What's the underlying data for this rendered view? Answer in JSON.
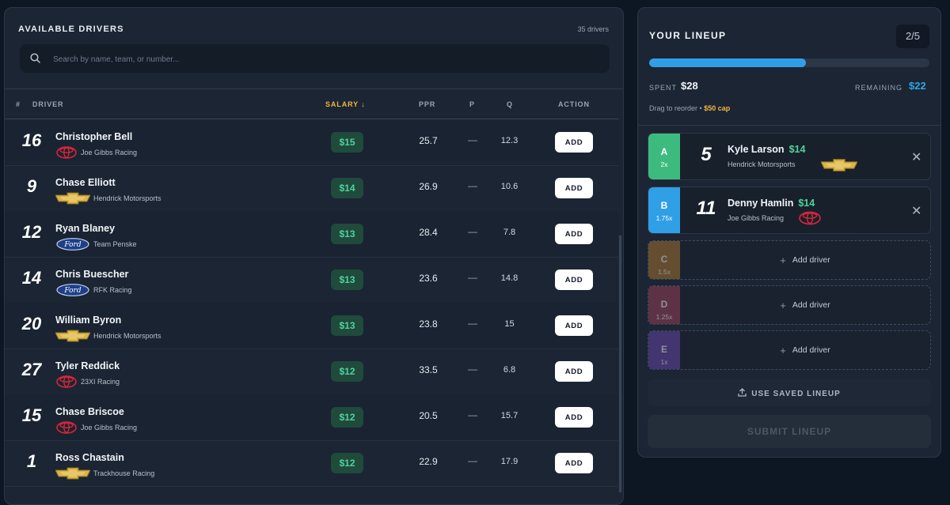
{
  "available": {
    "title": "AVAILABLE DRIVERS",
    "count": "35 drivers",
    "search_placeholder": "Search by name, team, or number...",
    "columns": {
      "num": "#",
      "driver": "DRIVER",
      "salary": "SALARY ↓",
      "ppr": "PPR",
      "p": "P",
      "q": "Q",
      "action": "ACTION"
    },
    "add_label": "ADD",
    "rows": [
      {
        "number": "16",
        "name": "Christopher Bell",
        "team": "Joe Gibbs Racing",
        "logo": "toyota-logo",
        "salary": "$15",
        "ppr": "25.7",
        "p": "—",
        "q": "12.3"
      },
      {
        "number": "9",
        "name": "Chase Elliott",
        "team": "Hendrick Motorsports",
        "logo": "chevrolet-logo",
        "salary": "$14",
        "ppr": "26.9",
        "p": "—",
        "q": "10.6"
      },
      {
        "number": "12",
        "name": "Ryan Blaney",
        "team": "Team Penske",
        "logo": "ford-logo",
        "salary": "$13",
        "ppr": "28.4",
        "p": "—",
        "q": "7.8"
      },
      {
        "number": "14",
        "name": "Chris Buescher",
        "team": "RFK Racing",
        "logo": "ford-logo",
        "salary": "$13",
        "ppr": "23.6",
        "p": "—",
        "q": "14.8"
      },
      {
        "number": "20",
        "name": "William Byron",
        "team": "Hendrick Motorsports",
        "logo": "chevrolet-logo",
        "salary": "$13",
        "ppr": "23.8",
        "p": "—",
        "q": "15"
      },
      {
        "number": "27",
        "name": "Tyler Reddick",
        "team": "23XI Racing",
        "logo": "toyota-logo",
        "salary": "$12",
        "ppr": "33.5",
        "p": "—",
        "q": "6.8"
      },
      {
        "number": "15",
        "name": "Chase Briscoe",
        "team": "Joe Gibbs Racing",
        "logo": "toyota-logo",
        "salary": "$12",
        "ppr": "20.5",
        "p": "—",
        "q": "15.7"
      },
      {
        "number": "1",
        "name": "Ross Chastain",
        "team": "Trackhouse Racing",
        "logo": "chevrolet-logo",
        "salary": "$12",
        "ppr": "22.9",
        "p": "—",
        "q": "17.9"
      }
    ]
  },
  "lineup": {
    "title": "YOUR LINEUP",
    "counter": "2/5",
    "progress_fraction": 0.56,
    "spent_label": "SPENT",
    "spent_value": "$28",
    "remaining_label": "REMAINING",
    "remaining_value": "$22",
    "hint": "Drag to reorder •",
    "cap": "$50 cap",
    "add_driver_label": "Add driver",
    "slots": [
      {
        "letter": "A",
        "multiplier": "2x",
        "color": "#3dbb7e",
        "number": "5",
        "name": "Kyle Larson",
        "salary": "$14",
        "team": "Hendrick Motorsports",
        "logo": "chevrolet-logo"
      },
      {
        "letter": "B",
        "multiplier": "1.75x",
        "color": "#2f9fe6",
        "number": "11",
        "name": "Denny Hamlin",
        "salary": "$14",
        "team": "Joe Gibbs Racing",
        "logo": "toyota-logo"
      },
      {
        "letter": "C",
        "multiplier": "1.5x",
        "color": "#b07a2f"
      },
      {
        "letter": "D",
        "multiplier": "1.25x",
        "color": "#a0435a"
      },
      {
        "letter": "E",
        "multiplier": "1x",
        "color": "#6a49b0"
      }
    ],
    "saved_label": "USE SAVED LINEUP",
    "submit_label": "SUBMIT LINEUP"
  },
  "colors": {
    "accent_green": "#4fd39b",
    "accent_blue": "#2fa6e8",
    "accent_gold": "#f0b63f"
  }
}
